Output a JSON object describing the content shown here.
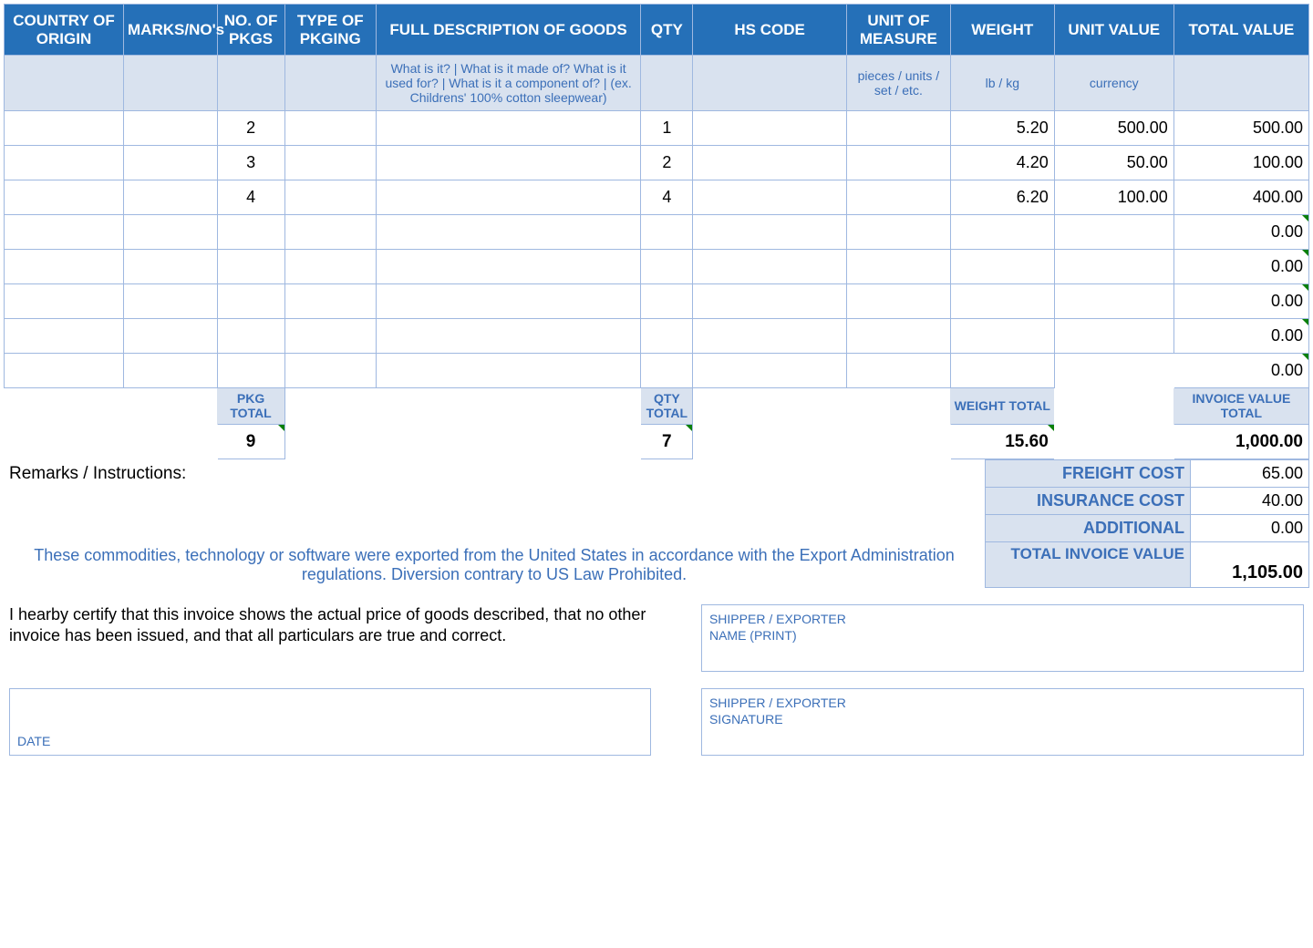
{
  "headers": {
    "country": "COUNTRY OF ORIGIN",
    "marks": "MARKS/NO's",
    "pkgs": "NO. OF PKGS",
    "pkgtype": "TYPE OF PKGING",
    "desc": "FULL DESCRIPTION OF GOODS",
    "qty": "QTY",
    "hs": "HS CODE",
    "uom": "UNIT OF MEASURE",
    "weight": "WEIGHT",
    "uv": "UNIT VALUE",
    "tv": "TOTAL VALUE"
  },
  "hints": {
    "desc": "What is it? | What is it made of? What is it used for? | What is it a component of? | (ex. Childrens' 100% cotton sleepwear)",
    "uom": "pieces / units / set / etc.",
    "weight": "lb / kg",
    "uv": "currency"
  },
  "rows": [
    {
      "pkgs": "2",
      "qty": "1",
      "weight": "5.20",
      "uv": "500.00",
      "tv": "500.00"
    },
    {
      "pkgs": "3",
      "qty": "2",
      "weight": "4.20",
      "uv": "50.00",
      "tv": "100.00"
    },
    {
      "pkgs": "4",
      "qty": "4",
      "weight": "6.20",
      "uv": "100.00",
      "tv": "400.00"
    },
    {
      "tv": "0.00"
    },
    {
      "tv": "0.00"
    },
    {
      "tv": "0.00"
    },
    {
      "tv": "0.00"
    },
    {
      "tv": "0.00"
    }
  ],
  "totals": {
    "pkg_label": "PKG TOTAL",
    "qty_label": "QTY TOTAL",
    "weight_label": "WEIGHT TOTAL",
    "inv_label": "INVOICE VALUE TOTAL",
    "pkg": "9",
    "qty": "7",
    "weight": "15.60",
    "invoice": "1,000.00"
  },
  "remarks_label": "Remarks / Instructions:",
  "costs": {
    "freight_label": "FREIGHT COST",
    "freight": "65.00",
    "insurance_label": "INSURANCE COST",
    "insurance": "40.00",
    "additional_label": "ADDITIONAL",
    "additional": "0.00",
    "total_label": "TOTAL INVOICE VALUE",
    "total": "1,105.00"
  },
  "compliance": "These commodities, technology or software were exported from the United States in accordance with the Export Administration regulations.  Diversion contrary to US Law Prohibited.",
  "certify": "I hearby certify that this invoice shows the actual price of goods described, that no other invoice has been issued, and that all particulars are true and correct.",
  "sig": {
    "name1": "SHIPPER / EXPORTER",
    "name2": "NAME (PRINT)",
    "sig1": "SHIPPER / EXPORTER",
    "sig2": "SIGNATURE",
    "date": "DATE"
  }
}
